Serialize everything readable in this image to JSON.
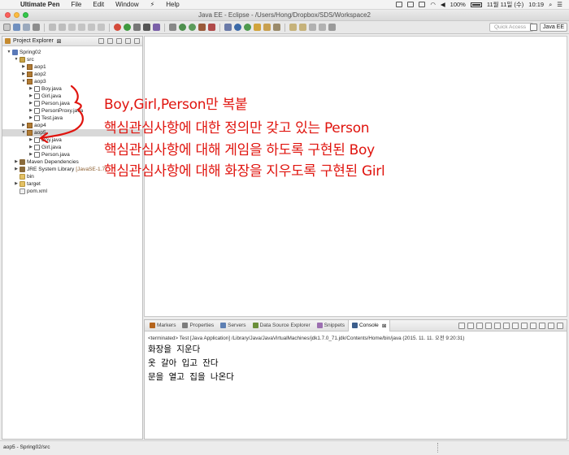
{
  "menubar": {
    "app_name": "Ultimate Pen",
    "menus": [
      "File",
      "Edit",
      "Window",
      "Help"
    ],
    "battery": "100%",
    "date": "11월 11일 (수)",
    "time": "10:19"
  },
  "window": {
    "title": "Java EE - Eclipse - /Users/Hong/Dropbox/SDS/Workspace2"
  },
  "toolbar": {
    "quick_access_placeholder": "Quick Access",
    "perspective_label": "Java EE"
  },
  "explorer": {
    "tab_label": "Project Explorer",
    "tab_close": "⊠",
    "tree": [
      {
        "label": "Spring02",
        "depth": 0,
        "twisty": "▼",
        "icon": "project"
      },
      {
        "label": "src",
        "depth": 1,
        "twisty": "▼",
        "icon": "srcfolder"
      },
      {
        "label": "aop1",
        "depth": 2,
        "twisty": "▶",
        "icon": "package"
      },
      {
        "label": "aop2",
        "depth": 2,
        "twisty": "▶",
        "icon": "package"
      },
      {
        "label": "aop3",
        "depth": 2,
        "twisty": "▼",
        "icon": "package"
      },
      {
        "label": "Boy.java",
        "depth": 3,
        "twisty": "▶",
        "icon": "java"
      },
      {
        "label": "Girl.java",
        "depth": 3,
        "twisty": "▶",
        "icon": "java"
      },
      {
        "label": "Person.java",
        "depth": 3,
        "twisty": "▶",
        "icon": "java"
      },
      {
        "label": "PersonProxy.java",
        "depth": 3,
        "twisty": "▶",
        "icon": "java"
      },
      {
        "label": "Test.java",
        "depth": 3,
        "twisty": "▶",
        "icon": "java"
      },
      {
        "label": "aop4",
        "depth": 2,
        "twisty": "▶",
        "icon": "package"
      },
      {
        "label": "aop5",
        "depth": 2,
        "twisty": "▼",
        "icon": "package",
        "selected": true
      },
      {
        "label": "Boy.java",
        "depth": 3,
        "twisty": "▶",
        "icon": "java"
      },
      {
        "label": "Girl.java",
        "depth": 3,
        "twisty": "▶",
        "icon": "java"
      },
      {
        "label": "Person.java",
        "depth": 3,
        "twisty": "▶",
        "icon": "java"
      },
      {
        "label": "Maven Dependencies",
        "depth": 1,
        "twisty": "▶",
        "icon": "jar"
      },
      {
        "label": "JRE System Library",
        "depth": 1,
        "twisty": "▶",
        "icon": "jar",
        "decoration": "[JavaSE-1.7]"
      },
      {
        "label": "bin",
        "depth": 1,
        "twisty": "",
        "icon": "folder"
      },
      {
        "label": "target",
        "depth": 1,
        "twisty": "▶",
        "icon": "folder"
      },
      {
        "label": "pom.xml",
        "depth": 1,
        "twisty": "",
        "icon": "file"
      }
    ]
  },
  "console": {
    "tabs": [
      {
        "label": "Markers",
        "color": "#b5651d"
      },
      {
        "label": "Properties",
        "color": "#7d7d7d"
      },
      {
        "label": "Servers",
        "color": "#5d7fb3"
      },
      {
        "label": "Data Source Explorer",
        "color": "#6a8f3a"
      },
      {
        "label": "Snippets",
        "color": "#9c6fb1"
      },
      {
        "label": "Console",
        "color": "#3c5e8c",
        "active": true
      }
    ],
    "close_glyph": "⊠",
    "status": "<terminated> Test [Java Application] /Library/Java/JavaVirtualMachines/jdk1.7.0_71.jdk/Contents/Home/bin/java (2015. 11. 11. 오전 9:20:31)",
    "output": [
      "화장을 지운다",
      "옷 갈아 입고 잔다",
      "문을 열고 집을 나온다"
    ]
  },
  "statusbar": {
    "text": "aop5 - Spring02/src"
  },
  "annotation": {
    "color": "#e0140e",
    "lines": [
      "Boy,Girl,Person만 복붙",
      "핵심관심사항에 대한 정의만 갖고 있는 Person",
      "핵심관심사항에 대해 게임을 하도록 구현된 Boy",
      "핵심관심사항에 대해 화장을 지우도록 구현된 Girl"
    ]
  }
}
